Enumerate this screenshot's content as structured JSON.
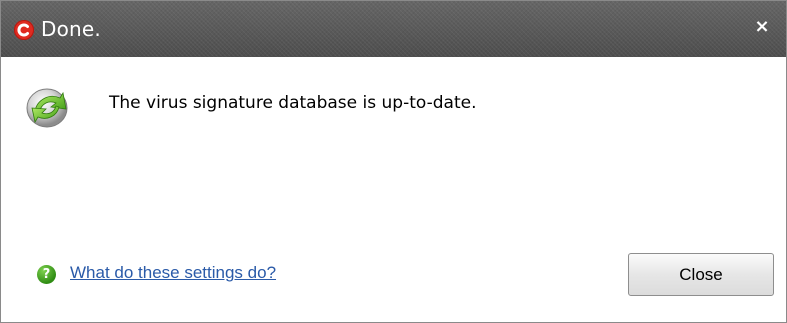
{
  "window": {
    "title": "Done.",
    "close_glyph": "×",
    "app_icon": "comodo-logo-icon"
  },
  "main": {
    "status_icon": "update-check-icon",
    "message": "The virus signature database is up-to-date."
  },
  "footer": {
    "help_icon": "help-question-icon",
    "help_glyph": "?",
    "help_link": "What do these settings do?",
    "close_label": "Close"
  },
  "colors": {
    "titlebar": "#5a5a5a",
    "accent_red": "#e02a20",
    "link": "#2a5aa8",
    "help_green": "#3a9a1a"
  }
}
